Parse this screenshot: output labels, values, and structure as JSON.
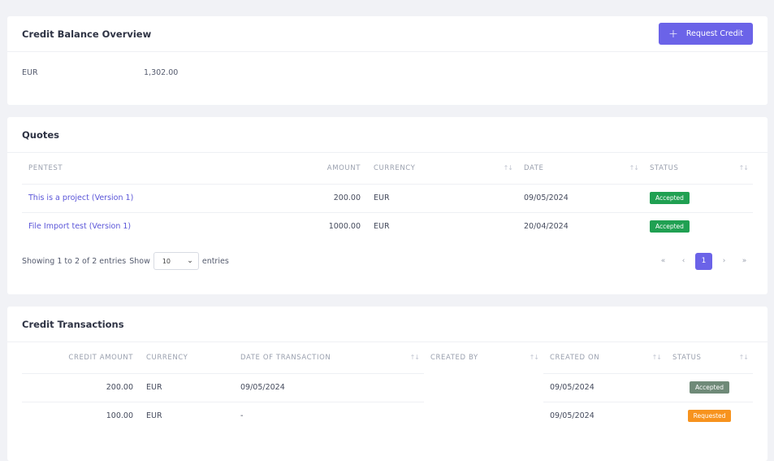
{
  "balance": {
    "title": "Credit Balance Overview",
    "request_label": "Request Credit",
    "currency": "EUR",
    "amount": "1,302.00"
  },
  "quotes": {
    "title": "Quotes",
    "columns": [
      "PENTEST",
      "AMOUNT",
      "CURRENCY",
      "DATE",
      "STATUS"
    ],
    "rows": [
      {
        "pentest": "This is a project (Version 1)",
        "amount": "200.00",
        "currency": "EUR",
        "date": "09/05/2024",
        "status": "Accepted"
      },
      {
        "pentest": "File Import test (Version 1)",
        "amount": "1000.00",
        "currency": "EUR",
        "date": "20/04/2024",
        "status": "Accepted"
      }
    ],
    "footer": {
      "showing": "Showing 1 to 2 of 2 entries",
      "show": "Show",
      "page_size": "10",
      "entries": "entries",
      "current_page": "1"
    }
  },
  "transactions": {
    "title": "Credit Transactions",
    "columns": [
      "CREDIT AMOUNT",
      "CURRENCY",
      "DATE OF TRANSACTION",
      "CREATED BY",
      "CREATED ON",
      "STATUS"
    ],
    "rows": [
      {
        "amount": "200.00",
        "currency": "EUR",
        "date": "09/05/2024",
        "created_by": "",
        "created_on": "09/05/2024",
        "status": "Accepted"
      },
      {
        "amount": "100.00",
        "currency": "EUR",
        "date": "-",
        "created_by": "",
        "created_on": "09/05/2024",
        "status": "Requested"
      }
    ]
  },
  "colors": {
    "accent": "#6b63e8",
    "accepted": "#20a052",
    "accepted_muted": "#6f8a78",
    "requested": "#f7931e"
  },
  "icons": {
    "request": "plus-icon",
    "sort": "sort-arrows-icon",
    "select": "chevron-down-icon",
    "first": "double-chevron-left-icon",
    "prev": "chevron-left-icon",
    "next": "chevron-right-icon",
    "last": "double-chevron-right-icon"
  }
}
